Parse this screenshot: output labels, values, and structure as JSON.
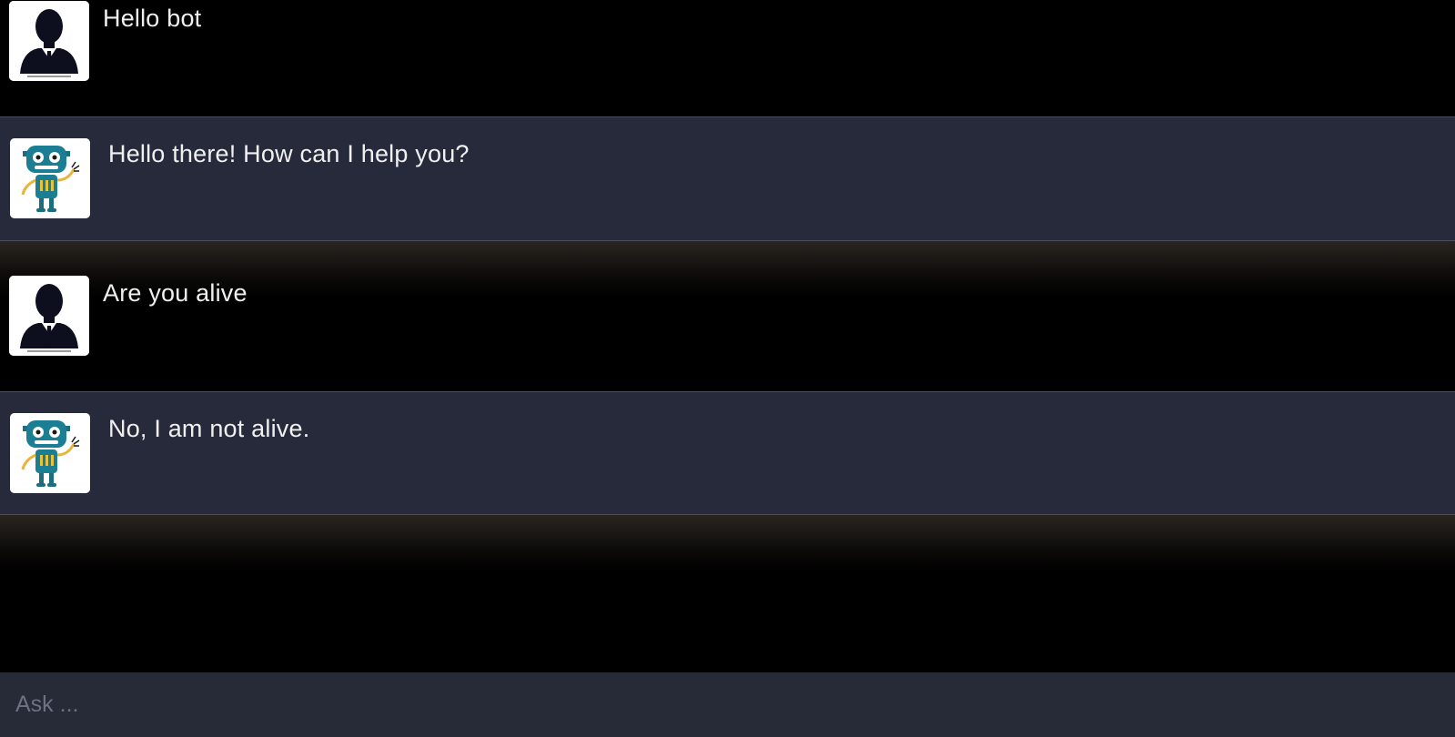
{
  "messages": [
    {
      "role": "user",
      "avatar_icon": "user-silhouette-icon",
      "text": "Hello bot"
    },
    {
      "role": "bot",
      "avatar_icon": "robot-icon",
      "text": "Hello there! How can I help you?"
    },
    {
      "role": "user",
      "avatar_icon": "user-silhouette-icon",
      "text": "Are you alive"
    },
    {
      "role": "bot",
      "avatar_icon": "robot-icon",
      "text": "No, I am not alive."
    }
  ],
  "input": {
    "placeholder": "Ask ...",
    "value": ""
  },
  "colors": {
    "user_row_bg": "#000000",
    "bot_row_bg": "#272a3a",
    "input_bg": "#272a37",
    "text": "#f0f0f0",
    "placeholder": "#6e7180"
  }
}
